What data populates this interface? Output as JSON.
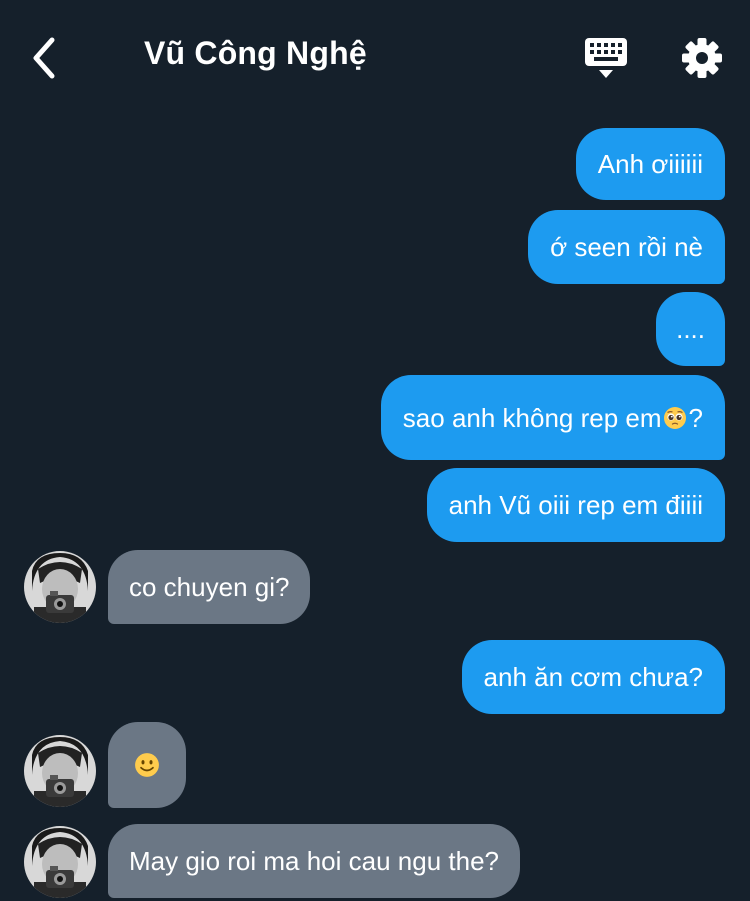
{
  "header": {
    "contact_name": "Vũ Công Nghệ",
    "back_icon": "chevron-left-icon",
    "keyboard_icon": "keyboard-icon",
    "settings_icon": "gear-icon"
  },
  "colors": {
    "background": "#15202b",
    "sent_bubble": "#1d9bf0",
    "received_bubble": "#6b7785",
    "text": "#ffffff"
  },
  "messages": [
    {
      "from": "me",
      "text": "Anh ơiiiiii"
    },
    {
      "from": "me",
      "text": "ớ seen rồi nè"
    },
    {
      "from": "me",
      "text": "...."
    },
    {
      "from": "me",
      "text_before": "sao anh không rep em",
      "emoji": "pleading-face-emoji",
      "text_after": " ?"
    },
    {
      "from": "me",
      "text": "anh Vũ oiii rep em điiii"
    },
    {
      "from": "them",
      "text": "co chuyen gi?"
    },
    {
      "from": "me",
      "text": "anh ăn cơm chưa?"
    },
    {
      "from": "them",
      "emoji": "slightly-smiling-face-emoji"
    },
    {
      "from": "them",
      "text": "May gio roi ma hoi cau ngu the?"
    }
  ]
}
